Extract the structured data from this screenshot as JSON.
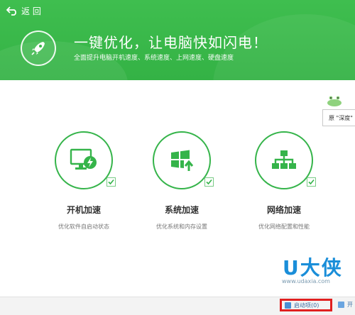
{
  "header": {
    "back_label": "返 回",
    "headline": "一键优化，让电脑快如闪电！",
    "subline": "全面提升电脑开机速度、系统速度、上网速度、硬盘速度"
  },
  "cards": [
    {
      "title": "开机加速",
      "desc": "优化软件自启动状态",
      "icon": "monitor-bolt-icon"
    },
    {
      "title": "系统加速",
      "desc": "优化系统和内存设置",
      "icon": "windows-icon"
    },
    {
      "title": "网络加速",
      "desc": "优化网络配置和性能",
      "icon": "network-icon"
    }
  ],
  "side_bubble": "原 \"深度\"",
  "watermark": {
    "big": "U大侠",
    "small": "www.udaxia.com"
  },
  "bottom": {
    "startup_label": "启动项(0)",
    "open_label": "开"
  },
  "colors": {
    "accent": "#35b44a",
    "highlight": "#e02020"
  }
}
